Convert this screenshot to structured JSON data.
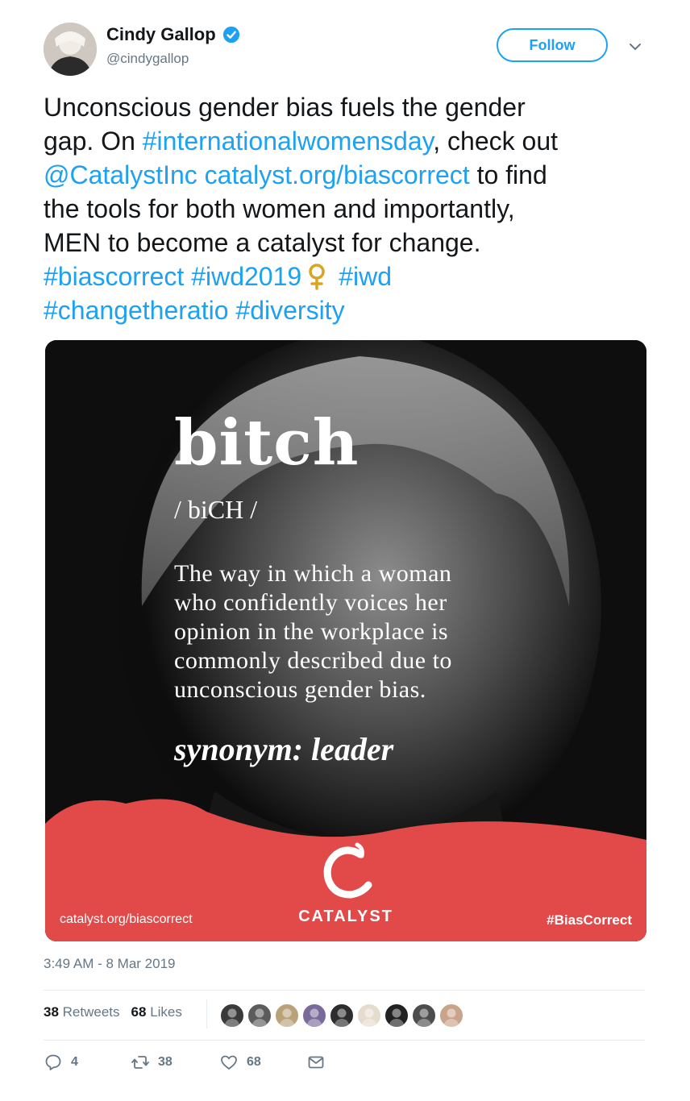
{
  "author": {
    "name": "Cindy Gallop",
    "handle": "@cindygallop",
    "follow_label": "Follow"
  },
  "tweet": {
    "lines": [
      [
        {
          "t": "Unconscious gender bias fuels the gender",
          "link": false
        }
      ],
      [
        {
          "t": "gap. On ",
          "link": false
        },
        {
          "t": "#internationalwomensday",
          "link": true
        },
        {
          "t": ", check out",
          "link": false
        }
      ],
      [
        {
          "t": "@CatalystInc",
          "link": true
        },
        {
          "t": " ",
          "link": false
        },
        {
          "t": "catalyst.org/biascorrect",
          "link": true
        },
        {
          "t": " to find",
          "link": false
        }
      ],
      [
        {
          "t": "the tools for both women and importantly,",
          "link": false
        }
      ],
      [
        {
          "t": "MEN to become a catalyst for change.",
          "link": false
        }
      ]
    ],
    "hashtags_line1": [
      "#biascorrect",
      "#iwd2019",
      "#iwd"
    ],
    "hashtags_line2": [
      "#changetheratio",
      "#diversity"
    ]
  },
  "card": {
    "word": "bitch",
    "pronunciation": "/ biCH /",
    "definition_lines": [
      "The way in which a woman",
      "who confidently voices her",
      "opinion in the workplace is",
      "commonly described due to",
      "unconscious gender bias."
    ],
    "synonym": "synonym: leader",
    "url": "catalyst.org/biascorrect",
    "brand": "CATALYST",
    "hashtag": "#BiasCorrect",
    "accent_color": "#e24a4a"
  },
  "timestamp": "3:49 AM - 8 Mar 2019",
  "stats": {
    "retweets_count": "38",
    "retweets_label": "Retweets",
    "likes_count": "68",
    "likes_label": "Likes"
  },
  "liker_colors": [
    "#3a3a3a",
    "#5c5c5c",
    "#b9a27a",
    "#7a6a9a",
    "#2d2d2d",
    "#e6dccd",
    "#222222",
    "#4d4d4d",
    "#c9a38a"
  ],
  "actions": {
    "reply_count": "4",
    "retweet_count": "38",
    "like_count": "68"
  },
  "colors": {
    "link": "#1da1f2",
    "secondary_text": "#657786"
  }
}
